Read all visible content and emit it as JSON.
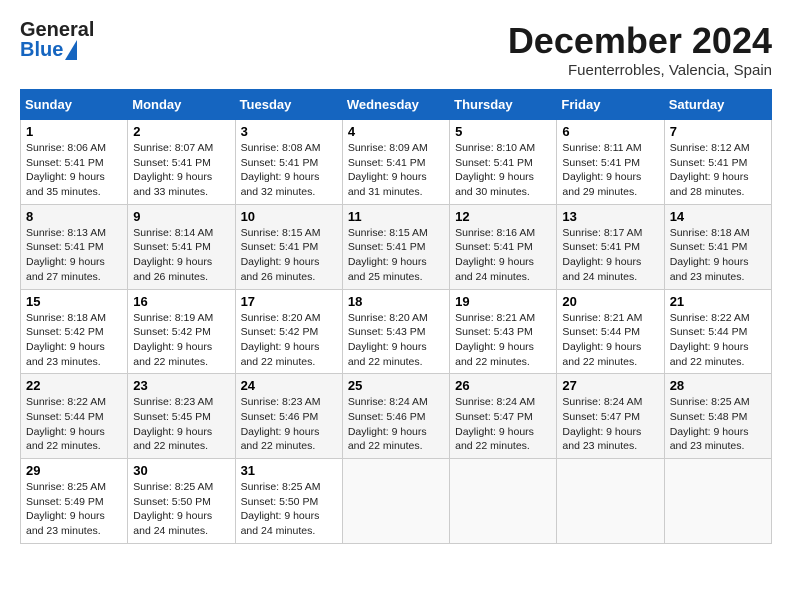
{
  "header": {
    "logo_general": "General",
    "logo_blue": "Blue",
    "title": "December 2024",
    "location": "Fuenterrobles, Valencia, Spain"
  },
  "days_of_week": [
    "Sunday",
    "Monday",
    "Tuesday",
    "Wednesday",
    "Thursday",
    "Friday",
    "Saturday"
  ],
  "weeks": [
    [
      {
        "day": "1",
        "sunrise": "Sunrise: 8:06 AM",
        "sunset": "Sunset: 5:41 PM",
        "daylight": "Daylight: 9 hours and 35 minutes."
      },
      {
        "day": "2",
        "sunrise": "Sunrise: 8:07 AM",
        "sunset": "Sunset: 5:41 PM",
        "daylight": "Daylight: 9 hours and 33 minutes."
      },
      {
        "day": "3",
        "sunrise": "Sunrise: 8:08 AM",
        "sunset": "Sunset: 5:41 PM",
        "daylight": "Daylight: 9 hours and 32 minutes."
      },
      {
        "day": "4",
        "sunrise": "Sunrise: 8:09 AM",
        "sunset": "Sunset: 5:41 PM",
        "daylight": "Daylight: 9 hours and 31 minutes."
      },
      {
        "day": "5",
        "sunrise": "Sunrise: 8:10 AM",
        "sunset": "Sunset: 5:41 PM",
        "daylight": "Daylight: 9 hours and 30 minutes."
      },
      {
        "day": "6",
        "sunrise": "Sunrise: 8:11 AM",
        "sunset": "Sunset: 5:41 PM",
        "daylight": "Daylight: 9 hours and 29 minutes."
      },
      {
        "day": "7",
        "sunrise": "Sunrise: 8:12 AM",
        "sunset": "Sunset: 5:41 PM",
        "daylight": "Daylight: 9 hours and 28 minutes."
      }
    ],
    [
      {
        "day": "8",
        "sunrise": "Sunrise: 8:13 AM",
        "sunset": "Sunset: 5:41 PM",
        "daylight": "Daylight: 9 hours and 27 minutes."
      },
      {
        "day": "9",
        "sunrise": "Sunrise: 8:14 AM",
        "sunset": "Sunset: 5:41 PM",
        "daylight": "Daylight: 9 hours and 26 minutes."
      },
      {
        "day": "10",
        "sunrise": "Sunrise: 8:15 AM",
        "sunset": "Sunset: 5:41 PM",
        "daylight": "Daylight: 9 hours and 26 minutes."
      },
      {
        "day": "11",
        "sunrise": "Sunrise: 8:15 AM",
        "sunset": "Sunset: 5:41 PM",
        "daylight": "Daylight: 9 hours and 25 minutes."
      },
      {
        "day": "12",
        "sunrise": "Sunrise: 8:16 AM",
        "sunset": "Sunset: 5:41 PM",
        "daylight": "Daylight: 9 hours and 24 minutes."
      },
      {
        "day": "13",
        "sunrise": "Sunrise: 8:17 AM",
        "sunset": "Sunset: 5:41 PM",
        "daylight": "Daylight: 9 hours and 24 minutes."
      },
      {
        "day": "14",
        "sunrise": "Sunrise: 8:18 AM",
        "sunset": "Sunset: 5:41 PM",
        "daylight": "Daylight: 9 hours and 23 minutes."
      }
    ],
    [
      {
        "day": "15",
        "sunrise": "Sunrise: 8:18 AM",
        "sunset": "Sunset: 5:42 PM",
        "daylight": "Daylight: 9 hours and 23 minutes."
      },
      {
        "day": "16",
        "sunrise": "Sunrise: 8:19 AM",
        "sunset": "Sunset: 5:42 PM",
        "daylight": "Daylight: 9 hours and 22 minutes."
      },
      {
        "day": "17",
        "sunrise": "Sunrise: 8:20 AM",
        "sunset": "Sunset: 5:42 PM",
        "daylight": "Daylight: 9 hours and 22 minutes."
      },
      {
        "day": "18",
        "sunrise": "Sunrise: 8:20 AM",
        "sunset": "Sunset: 5:43 PM",
        "daylight": "Daylight: 9 hours and 22 minutes."
      },
      {
        "day": "19",
        "sunrise": "Sunrise: 8:21 AM",
        "sunset": "Sunset: 5:43 PM",
        "daylight": "Daylight: 9 hours and 22 minutes."
      },
      {
        "day": "20",
        "sunrise": "Sunrise: 8:21 AM",
        "sunset": "Sunset: 5:44 PM",
        "daylight": "Daylight: 9 hours and 22 minutes."
      },
      {
        "day": "21",
        "sunrise": "Sunrise: 8:22 AM",
        "sunset": "Sunset: 5:44 PM",
        "daylight": "Daylight: 9 hours and 22 minutes."
      }
    ],
    [
      {
        "day": "22",
        "sunrise": "Sunrise: 8:22 AM",
        "sunset": "Sunset: 5:44 PM",
        "daylight": "Daylight: 9 hours and 22 minutes."
      },
      {
        "day": "23",
        "sunrise": "Sunrise: 8:23 AM",
        "sunset": "Sunset: 5:45 PM",
        "daylight": "Daylight: 9 hours and 22 minutes."
      },
      {
        "day": "24",
        "sunrise": "Sunrise: 8:23 AM",
        "sunset": "Sunset: 5:46 PM",
        "daylight": "Daylight: 9 hours and 22 minutes."
      },
      {
        "day": "25",
        "sunrise": "Sunrise: 8:24 AM",
        "sunset": "Sunset: 5:46 PM",
        "daylight": "Daylight: 9 hours and 22 minutes."
      },
      {
        "day": "26",
        "sunrise": "Sunrise: 8:24 AM",
        "sunset": "Sunset: 5:47 PM",
        "daylight": "Daylight: 9 hours and 22 minutes."
      },
      {
        "day": "27",
        "sunrise": "Sunrise: 8:24 AM",
        "sunset": "Sunset: 5:47 PM",
        "daylight": "Daylight: 9 hours and 23 minutes."
      },
      {
        "day": "28",
        "sunrise": "Sunrise: 8:25 AM",
        "sunset": "Sunset: 5:48 PM",
        "daylight": "Daylight: 9 hours and 23 minutes."
      }
    ],
    [
      {
        "day": "29",
        "sunrise": "Sunrise: 8:25 AM",
        "sunset": "Sunset: 5:49 PM",
        "daylight": "Daylight: 9 hours and 23 minutes."
      },
      {
        "day": "30",
        "sunrise": "Sunrise: 8:25 AM",
        "sunset": "Sunset: 5:50 PM",
        "daylight": "Daylight: 9 hours and 24 minutes."
      },
      {
        "day": "31",
        "sunrise": "Sunrise: 8:25 AM",
        "sunset": "Sunset: 5:50 PM",
        "daylight": "Daylight: 9 hours and 24 minutes."
      },
      null,
      null,
      null,
      null
    ]
  ]
}
